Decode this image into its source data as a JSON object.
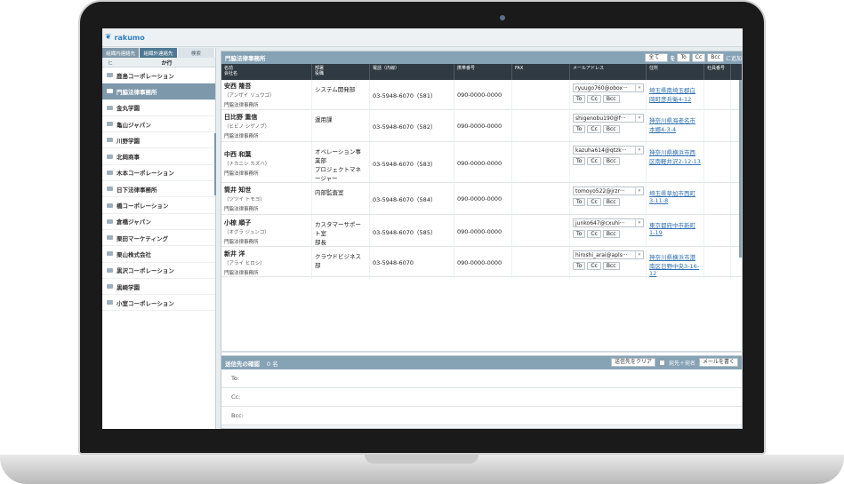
{
  "app": {
    "logo": "rakumo",
    "logo_icon": "rakumo-logo-icon"
  },
  "left": {
    "tabs": [
      "組織内連絡先",
      "組織外連絡先",
      "検索"
    ],
    "kana_left": "ヒ",
    "kana_header": "か行",
    "companies": [
      "鹿島コーポレーション",
      "門脇法律事務所",
      "金丸学園",
      "亀山ジャパン",
      "川野学園",
      "北岡商事",
      "木本コーポレーション",
      "日下法律事務所",
      "橋コーポレーション",
      "倉橋ジャパン",
      "栗田マーケティング",
      "栗山株式会社",
      "黒沢コーポレーション",
      "黒崎学園",
      "小室コーポレーション"
    ],
    "selected": "門脇法律事務所"
  },
  "main": {
    "title": "門脇法律事務所",
    "select_label": "全て",
    "to": "To",
    "cc": "Cc",
    "bcc": "Bcc",
    "arrow": "を",
    "add_label": "に追加",
    "headers": {
      "name": "名前\n会社名",
      "dept": "部署\n役職",
      "phone": "電話（内線）",
      "mobile": "携帯番号",
      "fax": "FAX",
      "email": "メールアドレス",
      "address": "住所",
      "empno": "社員番号"
    },
    "rows": [
      {
        "name": "安西 隆吾",
        "kana": "（アンザイ リュウゴ）",
        "company": "門脇法律事務所",
        "dept": "システム開発部",
        "phone": "03-5948-6070（581）",
        "mobile": "090-0000-0000",
        "email": "ryuugo760@obox···",
        "address": "埼玉県南埼玉郡白岡町彦兵衛4-12"
      },
      {
        "name": "日比野 重信",
        "kana": "（ヒビノ シゲノブ）",
        "company": "門脇法律事務所",
        "dept": "運用課",
        "phone": "03-5948-6070（582）",
        "mobile": "090-0000-0000",
        "email": "shigenobu190@f···",
        "address": "神奈川県海老名市本郷4-3-4"
      },
      {
        "name": "中西 和葉",
        "kana": "（ナカニシ カズハ）",
        "company": "門脇法律事務所",
        "dept": "オペレーション事業部\nプロジェクトマネージャー",
        "phone": "03-5948-6070（583）",
        "mobile": "090-0000-0000",
        "email": "kazuha614@qtzk···",
        "address": "神奈川県横浜市西区南軽井沢2-12-13"
      },
      {
        "name": "筒井 知世",
        "kana": "（ツツイ トモヨ）",
        "company": "門脇法律事務所",
        "dept": "内部監査室",
        "phone": "03-5948-6070（584）",
        "mobile": "090-0000-0000",
        "email": "tomoyo522@jrzr···",
        "address": "埼玉県草加市西町3-11-8"
      },
      {
        "name": "小椋 順子",
        "kana": "（オグラ ジュンコ）",
        "company": "門脇法律事務所",
        "dept": "カスタマーサポート室\n部長",
        "phone": "03-5948-6070（585）",
        "mobile": "090-0000-0000",
        "email": "junko647@cxuhi···",
        "address": "東京都府中市新町1-19"
      },
      {
        "name": "新井 洋",
        "kana": "（アライ ヒロシ）",
        "company": "門脇法律事務所",
        "dept": "クラウドビジネス部",
        "phone": "03-5948-6070",
        "mobile": "090-0000-0000",
        "email": "hiroshi_arai@apls···",
        "address": "神奈川県横浜市港南区日野中央3-16-12"
      }
    ]
  },
  "confirm": {
    "title": "送信先の確認",
    "count": "0 名",
    "clear": "送信先をクリア",
    "checkbox_label": "宛先＋宛名",
    "compose": "メールを書く",
    "to": "To:",
    "cc": "Cc:",
    "bcc": "Bcc:"
  }
}
